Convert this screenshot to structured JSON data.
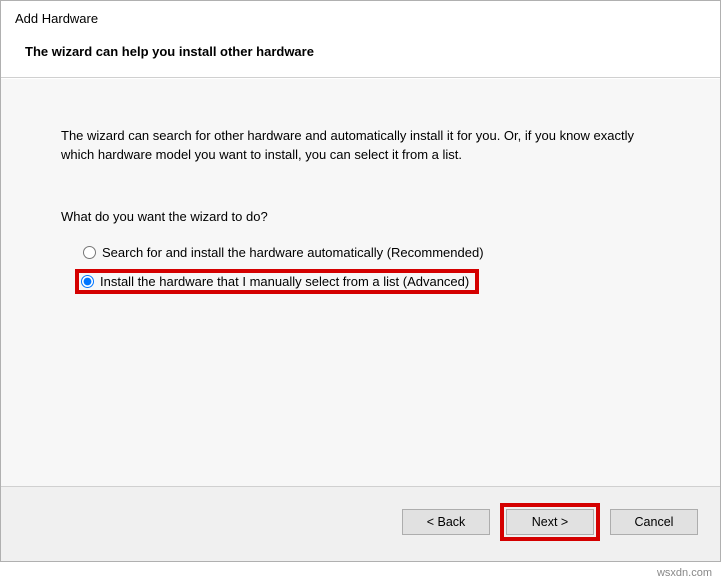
{
  "window": {
    "title": "Add Hardware"
  },
  "wizard": {
    "heading": "The wizard can help you install other hardware",
    "intro": "The wizard can search for other hardware and automatically install it for you. Or, if you know exactly which hardware model you want to install, you can select it from a list.",
    "question": "What do you want the wizard to do?",
    "options": [
      {
        "label": "Search for and install the hardware automatically (Recommended)",
        "selected": false
      },
      {
        "label": "Install the hardware that I manually select from a list (Advanced)",
        "selected": true
      }
    ]
  },
  "buttons": {
    "back": "< Back",
    "next": "Next >",
    "cancel": "Cancel"
  },
  "watermark": "wsxdn.com"
}
